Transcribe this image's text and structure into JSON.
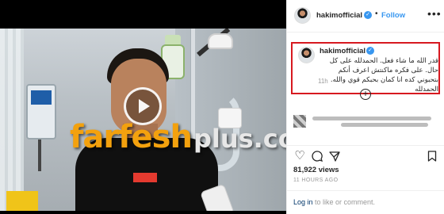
{
  "video": {
    "watermark_main": "farfesh",
    "watermark_plus": "plus.com"
  },
  "header": {
    "username": "hakimofficial",
    "verified_mark": "✓",
    "separator": "•",
    "follow_label": "Follow",
    "more_label": "•••"
  },
  "caption": {
    "username": "hakimofficial",
    "text": "قدر الله ما شاء فعل. الحمدلله على كل حال. على فكره ماكنتش اعرف أنكم بتحبوني كده انا كمان بحبكم قوي والله. الحمدلله",
    "time": "11h"
  },
  "comment": {
    "add_icon": "+"
  },
  "stats": {
    "views": "81,922 views",
    "time_ago": "11 HOURS AGO"
  },
  "footer": {
    "login_link": "Log in",
    "login_rest": " to like or comment."
  },
  "colors": {
    "accent": "#3897f0",
    "highlight_border": "#d71920",
    "watermark": "#f3a10e"
  }
}
